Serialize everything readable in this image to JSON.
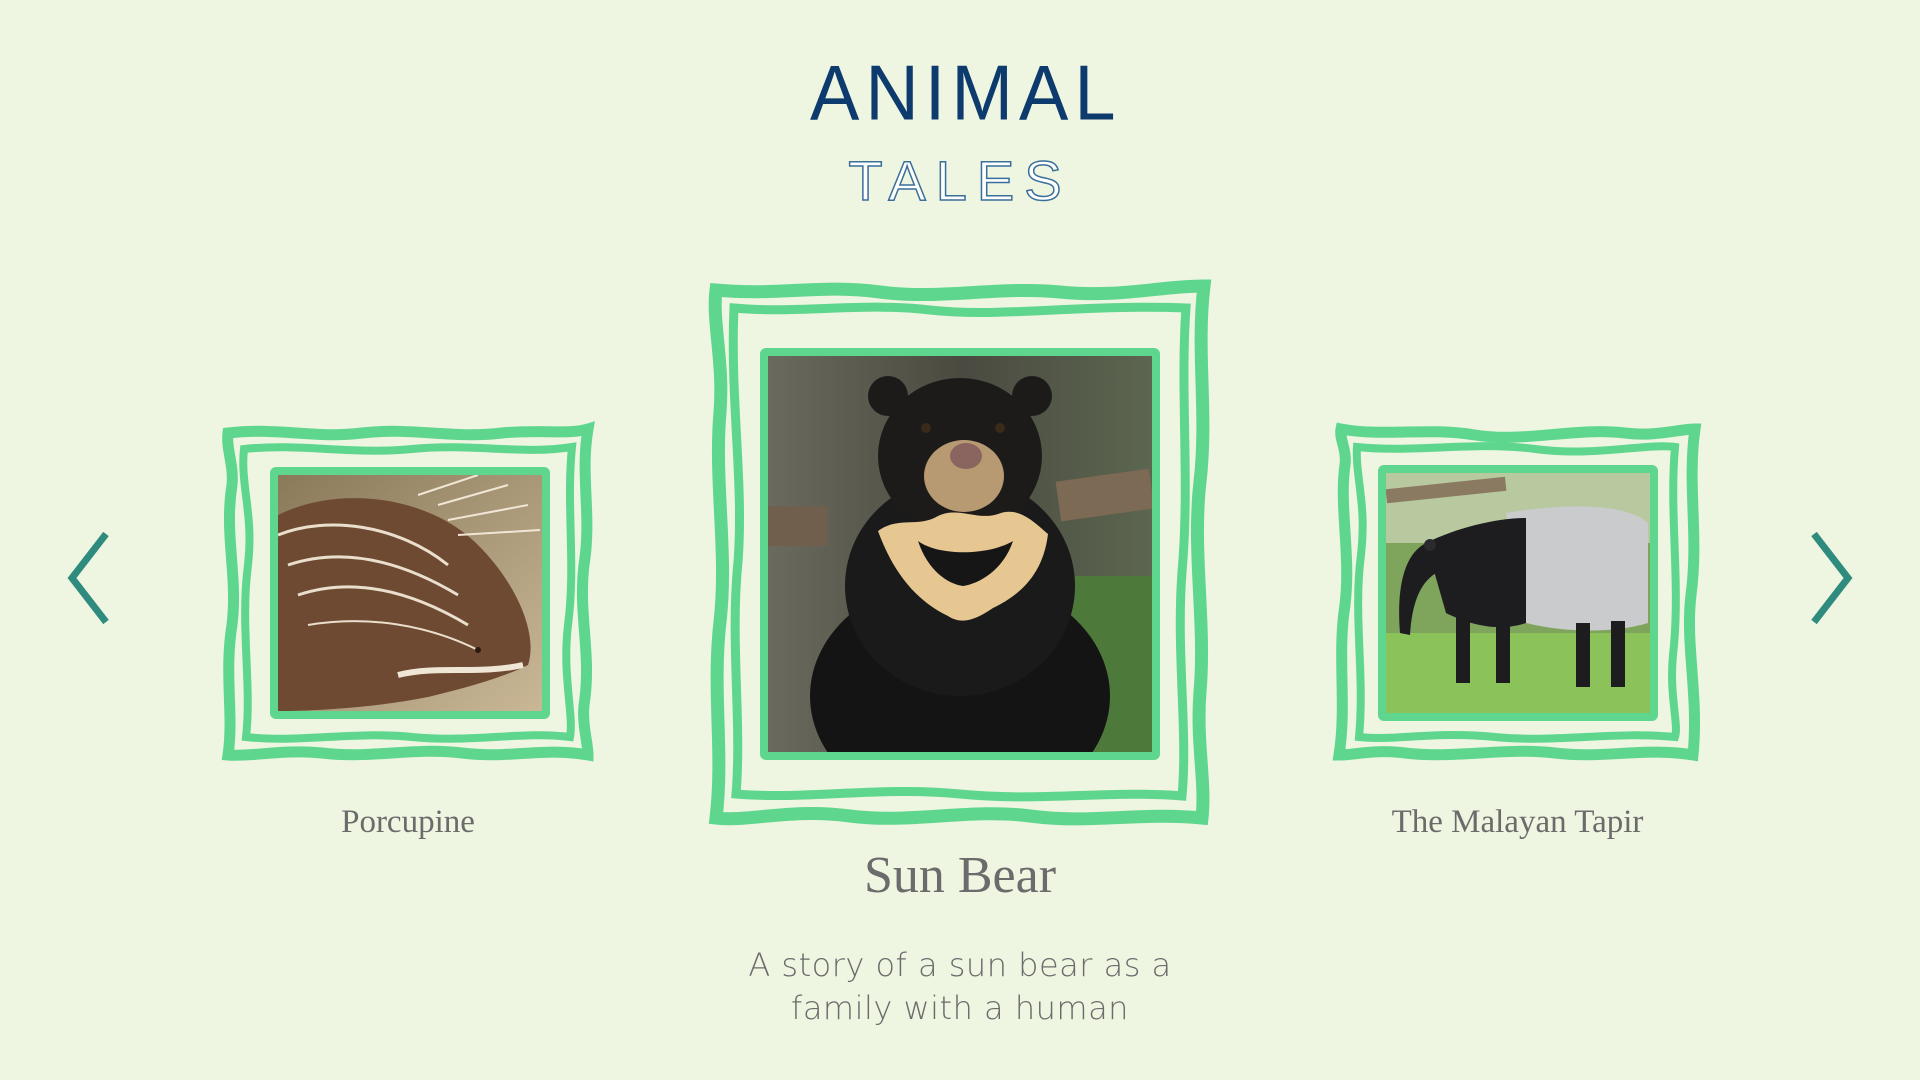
{
  "app": {
    "logo_line1": "ANIMAL",
    "logo_line2": "TALES"
  },
  "carousel": {
    "items": [
      {
        "title": "Porcupine",
        "image": "porcupine-photo"
      },
      {
        "title": "Sun Bear",
        "image": "sun-bear-photo",
        "description": "A story of a sun bear as a family with a human"
      },
      {
        "title": "The Malayan Tapir",
        "image": "malayan-tapir-photo"
      }
    ],
    "prev_icon": "chevron-left-icon",
    "next_icon": "chevron-right-icon"
  },
  "colors": {
    "background": "#eef5e1",
    "frame_green": "#5fd68e",
    "arrow_teal": "#2e8b7d",
    "logo_navy": "#0d3b6e",
    "caption_gray": "#6b6b6b"
  }
}
